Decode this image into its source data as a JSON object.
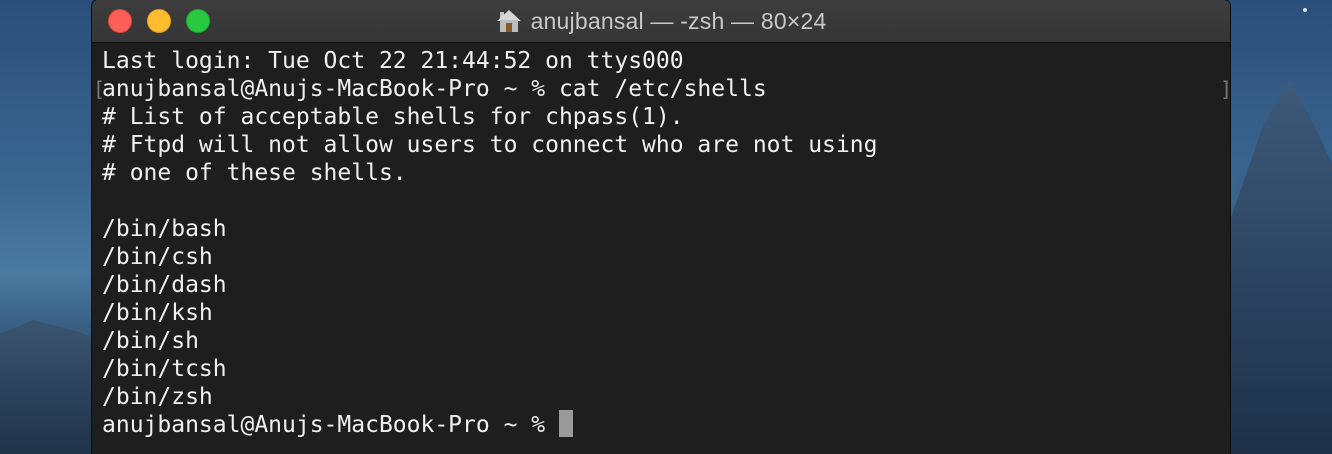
{
  "window": {
    "title": "anujbansal — -zsh — 80×24",
    "title_icon": "home-folder-icon",
    "buttons": {
      "close": "close-button",
      "minimize": "minimize-button",
      "zoom": "zoom-button"
    }
  },
  "terminal": {
    "lines": [
      "Last login: Tue Oct 22 21:44:52 on ttys000",
      "anujbansal@Anujs-MacBook-Pro ~ % cat /etc/shells",
      "# List of acceptable shells for chpass(1).",
      "# Ftpd will not allow users to connect who are not using",
      "# one of these shells.",
      "",
      "/bin/bash",
      "/bin/csh",
      "/bin/dash",
      "/bin/ksh",
      "/bin/sh",
      "/bin/tcsh",
      "/bin/zsh"
    ],
    "prompt": "anujbansal@Anujs-MacBook-Pro ~ % ",
    "bracket_left": "[",
    "bracket_right": "]"
  },
  "colors": {
    "background": "#1e1e1e",
    "text": "#f0f0f0",
    "cursor": "#9a9a9a",
    "close": "#fd5f57",
    "minimize": "#febc2e",
    "zoom": "#28c840"
  }
}
